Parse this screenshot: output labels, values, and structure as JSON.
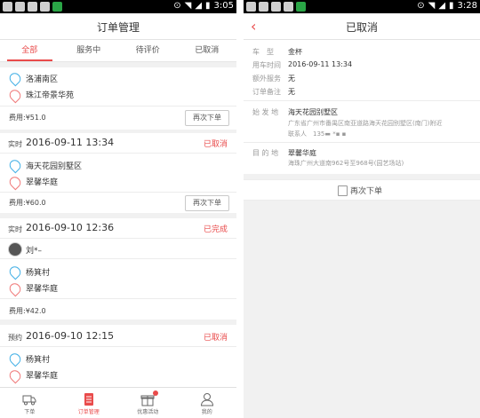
{
  "left_status": {
    "time": "3:05"
  },
  "right_status": {
    "time": "3:28"
  },
  "left": {
    "title": "订单管理",
    "tabs": [
      "全部",
      "服务中",
      "待评价",
      "已取消"
    ],
    "order0": {
      "start": "洛浦南区",
      "end": "珠江帝景华苑",
      "fee": "费用:¥51.0",
      "button": "再次下单"
    },
    "order1": {
      "type": "实时",
      "time": "2016-09-11 13:34",
      "status": "已取消",
      "start": "海天花园别墅区",
      "end": "翠馨华庭",
      "fee": "费用:¥60.0",
      "button": "再次下单"
    },
    "order2": {
      "type": "实时",
      "time": "2016-09-10 12:36",
      "status": "已完成",
      "driver": "刘*–",
      "start": "杨箕村",
      "end": "翠馨华庭",
      "fee": "费用:¥42.0"
    },
    "order3": {
      "type": "预约",
      "time": "2016-09-10 12:15",
      "status": "已取消",
      "start": "杨箕村",
      "end": "翠馨华庭"
    },
    "nav": [
      "下单",
      "订单管理",
      "优惠活动",
      "我的"
    ]
  },
  "right": {
    "title": "已取消",
    "car_type_label": "车　型",
    "car_type": "金杯",
    "time_label": "用车时间",
    "time": "2016-09-11 13:34",
    "extra_label": "额外服务",
    "extra": "无",
    "note_label": "订单备注",
    "note": "无",
    "from_label": "始 发 地",
    "from_name": "海天花园别墅区",
    "from_addr": "广东省广州市番禺区南亚道路海天花园别墅区(南门)附近",
    "contact": "联系人　135▬ *▪ ▪",
    "to_label": "目 的 地",
    "to_name": "翠馨华庭",
    "to_addr": "海珠广州大道南962号至968号(园艺场站)",
    "reorder": "再次下单"
  }
}
